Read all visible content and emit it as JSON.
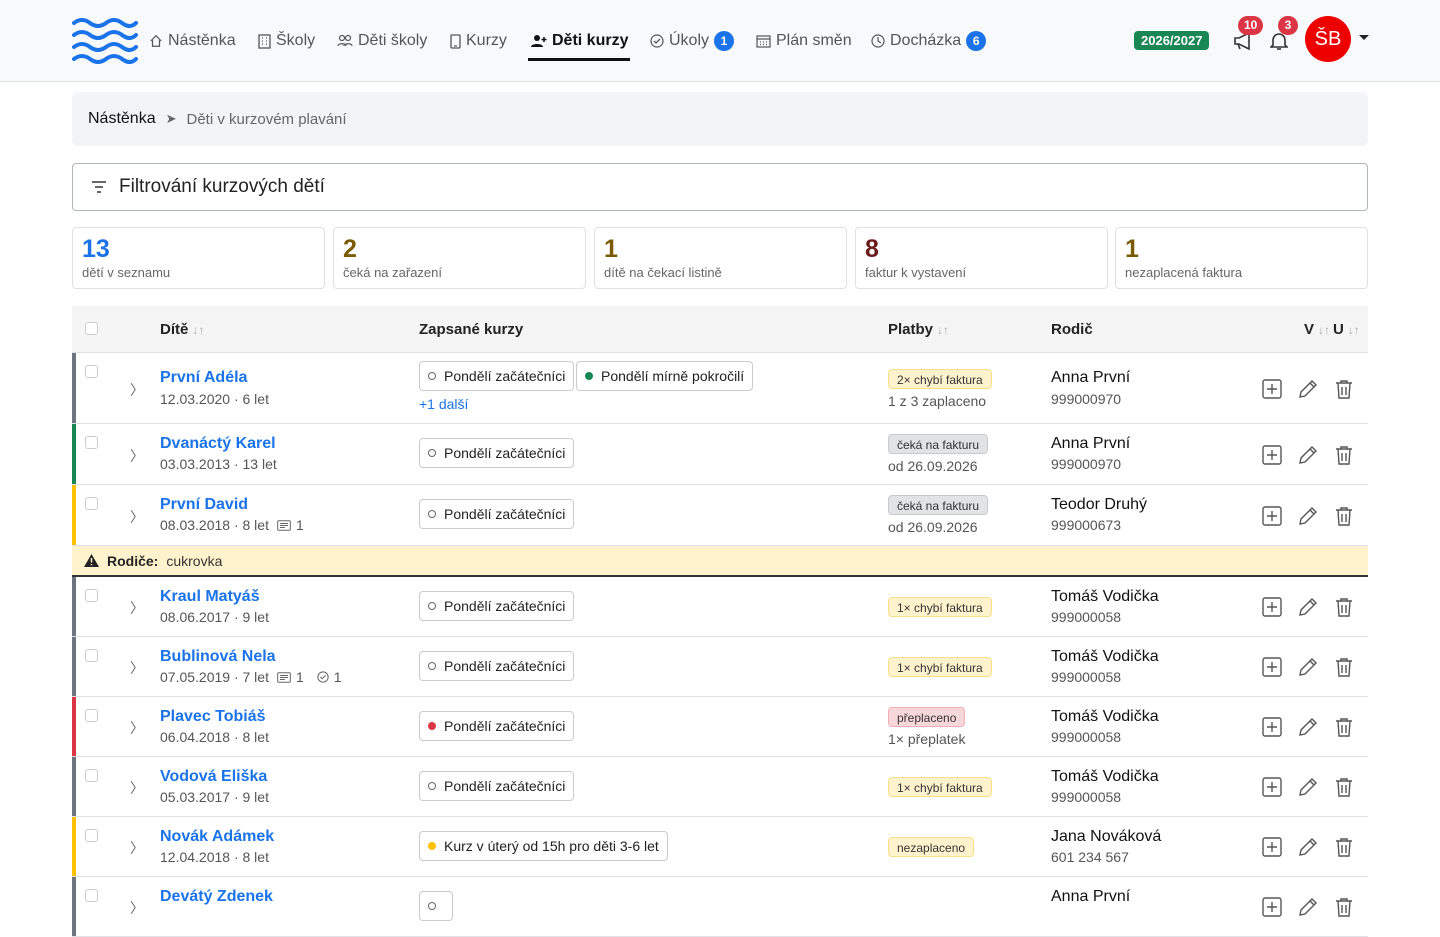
{
  "nav": {
    "items": [
      {
        "label": "Nástěnka",
        "icon": "home-icon"
      },
      {
        "label": "Školy",
        "icon": "building-icon"
      },
      {
        "label": "Děti školy",
        "icon": "people-icon"
      },
      {
        "label": "Kurzy",
        "icon": "tablet-icon"
      },
      {
        "label": "Děti kurzy",
        "icon": "people-add-icon",
        "active": true
      },
      {
        "label": "Úkoly",
        "icon": "check-circle-icon",
        "badge": "1"
      },
      {
        "label": "Plán směn",
        "icon": "calendar-icon"
      },
      {
        "label": "Docházka",
        "icon": "clock-icon",
        "badge": "6"
      }
    ],
    "year": "2026/2027",
    "announcements_count": "10",
    "notifications_count": "3",
    "avatar_initials": "ŠB"
  },
  "breadcrumb": {
    "home": "Nástěnka",
    "separator": "➤",
    "current": "Děti v kurzovém plavání"
  },
  "filter": {
    "label": "Filtrování kurzových dětí"
  },
  "stats": [
    {
      "value": "13",
      "label": "dětí v seznamu",
      "color": "#1a73e8"
    },
    {
      "value": "2",
      "label": "čeká na zařazení",
      "color": "#7a5b00"
    },
    {
      "value": "1",
      "label": "dítě na čekací listině",
      "color": "#7a5b00"
    },
    {
      "value": "8",
      "label": "faktur k vystavení",
      "color": "#6b1a1a"
    },
    {
      "value": "1",
      "label": "nezaplacená faktura",
      "color": "#7a5b00"
    }
  ],
  "table": {
    "headers": {
      "child": "Dítě",
      "courses": "Zapsané kurzy",
      "payments": "Platby",
      "parent": "Rodič",
      "v": "V",
      "u": "U"
    },
    "rows": [
      {
        "name": "První Adéla",
        "meta": "12.03.2020 · 6 let",
        "bar": "#6c757d",
        "courses": [
          {
            "label": "Pondělí začátečníci",
            "dot": "empty"
          },
          {
            "label": "Pondělí mírně pokročilí",
            "dot": "#198754"
          }
        ],
        "more": "+1 další",
        "payment": {
          "badge": "2× chybí faktura",
          "style": "yellow",
          "sub": "1 z 3 zaplaceno"
        },
        "parent": {
          "name": "Anna První",
          "phone": "999000970"
        }
      },
      {
        "name": "Dvanáctý Karel",
        "meta": "03.03.2013 · 13 let",
        "bar": "#198754",
        "courses": [
          {
            "label": "Pondělí začátečníci",
            "dot": "empty"
          }
        ],
        "payment": {
          "badge": "čeká na fakturu",
          "style": "gray",
          "sub": "od 26.09.2026"
        },
        "parent": {
          "name": "Anna První",
          "phone": "999000970"
        }
      },
      {
        "name": "První David",
        "meta": "08.03.2018 · 8 let",
        "notes": "1",
        "bar": "#ffc107",
        "courses": [
          {
            "label": "Pondělí začátečníci",
            "dot": "empty"
          }
        ],
        "payment": {
          "badge": "čeká na fakturu",
          "style": "gray",
          "sub": "od 26.09.2026"
        },
        "parent": {
          "name": "Teodor Druhý",
          "phone": "999000673"
        }
      },
      {
        "name": "Kraul Matyáš",
        "meta": "08.06.2017 · 9 let",
        "bar": "#6c757d",
        "courses": [
          {
            "label": "Pondělí začátečníci",
            "dot": "empty"
          }
        ],
        "payment": {
          "badge": "1× chybí faktura",
          "style": "yellow",
          "sub": ""
        },
        "parent": {
          "name": "Tomáš Vodička",
          "phone": "999000058"
        }
      },
      {
        "name": "Bublinová Nela",
        "meta": "07.05.2019 · 7 let",
        "notes": "1",
        "tasks": "1",
        "bar": "#6c757d",
        "courses": [
          {
            "label": "Pondělí začátečníci",
            "dot": "empty"
          }
        ],
        "payment": {
          "badge": "1× chybí faktura",
          "style": "yellow",
          "sub": ""
        },
        "parent": {
          "name": "Tomáš Vodička",
          "phone": "999000058"
        }
      },
      {
        "name": "Plavec Tobiáš",
        "meta": "06.04.2018 · 8 let",
        "bar": "#dc3545",
        "courses": [
          {
            "label": "Pondělí začátečníci",
            "dot": "#dc3545"
          }
        ],
        "payment": {
          "badge": "přeplaceno",
          "style": "red",
          "sub": "1× přeplatek"
        },
        "parent": {
          "name": "Tomáš Vodička",
          "phone": "999000058"
        }
      },
      {
        "name": "Vodová Eliška",
        "meta": "05.03.2017 · 9 let",
        "bar": "#6c757d",
        "courses": [
          {
            "label": "Pondělí začátečníci",
            "dot": "empty"
          }
        ],
        "payment": {
          "badge": "1× chybí faktura",
          "style": "yellow",
          "sub": ""
        },
        "parent": {
          "name": "Tomáš Vodička",
          "phone": "999000058"
        }
      },
      {
        "name": "Novák Adámek",
        "meta": "12.04.2018 · 8 let",
        "bar": "#ffc107",
        "courses": [
          {
            "label": "Kurz v úterý od 15h pro děti 3-6 let",
            "dot": "#ffc107"
          }
        ],
        "payment": {
          "badge": "nezaplaceno",
          "style": "yellow",
          "sub": ""
        },
        "parent": {
          "name": "Jana Nováková",
          "phone": "601 234 567"
        }
      },
      {
        "name": "Devátý Zdenek",
        "meta": "",
        "bar": "#6c757d",
        "courses": [
          {
            "label": "",
            "dot": "empty"
          }
        ],
        "payment": {
          "badge": "",
          "style": "yellow",
          "sub": ""
        },
        "parent": {
          "name": "Anna První",
          "phone": ""
        }
      }
    ],
    "warning": {
      "label": "Rodiče:",
      "text": "cukrovka"
    }
  }
}
